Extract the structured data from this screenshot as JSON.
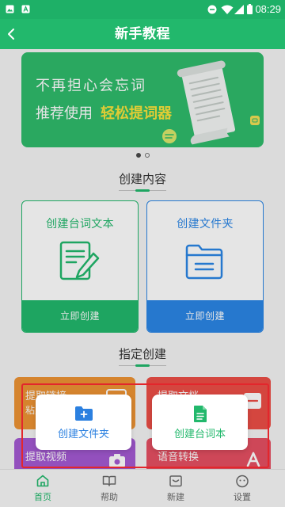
{
  "status_bar": {
    "time": "08:29",
    "icons": [
      "image-notification-icon",
      "text-notification-icon",
      "do-not-disturb-icon",
      "wifi-icon",
      "signal-icon",
      "battery-icon"
    ]
  },
  "colors": {
    "status_green": "#1eb067",
    "brand_green": "#22b86c",
    "banner_green": "#2fbb6b",
    "brand_blue": "#2b86e6",
    "highlight_yellow": "#f9e43c",
    "tutorial_red": "#e3262c"
  },
  "header": {
    "title": "新手教程",
    "back_icon": "chevron-left-icon"
  },
  "banner": {
    "line1": "不再担心会忘词",
    "line2_prefix": "推荐使用",
    "line2_highlight": "轻松提词器",
    "illustration": "paper-scroll-illustration",
    "slide_count": 2,
    "active_slide": 1
  },
  "create_section": {
    "title": "创建内容",
    "cards": [
      {
        "title": "创建台词文本",
        "action": "立即创建",
        "icon": "document-edit-icon",
        "color": "#22b86c"
      },
      {
        "title": "创建文件夹",
        "action": "立即创建",
        "icon": "folder-icon",
        "color": "#2b86e6"
      }
    ]
  },
  "specific_section": {
    "title": "指定创建",
    "tiles": [
      {
        "title": "提取链接",
        "subtitle": "粘贴",
        "icon": "link-box-icon",
        "color": "#ee9334"
      },
      {
        "title": "提取文档",
        "icon": "document-icon",
        "color": "#ec4f47"
      },
      {
        "title": "提取视频",
        "icon": "camera-icon",
        "color": "#a45ad3"
      },
      {
        "title": "语音转换",
        "icon": "text-a-icon",
        "color": "#e65063"
      }
    ]
  },
  "tutorial_popup": {
    "buttons": [
      {
        "label": "创建文件夹",
        "icon": "folder-plus-icon",
        "color": "#2b80e0"
      },
      {
        "label": "创建台词本",
        "icon": "document-filled-icon",
        "color": "#22b86c"
      }
    ]
  },
  "bottom_nav": {
    "active_index": 0,
    "items": [
      {
        "label": "首页",
        "icon": "home-icon"
      },
      {
        "label": "帮助",
        "icon": "book-icon"
      },
      {
        "label": "新建",
        "icon": "inbox-icon"
      },
      {
        "label": "设置",
        "icon": "face-icon"
      }
    ]
  }
}
